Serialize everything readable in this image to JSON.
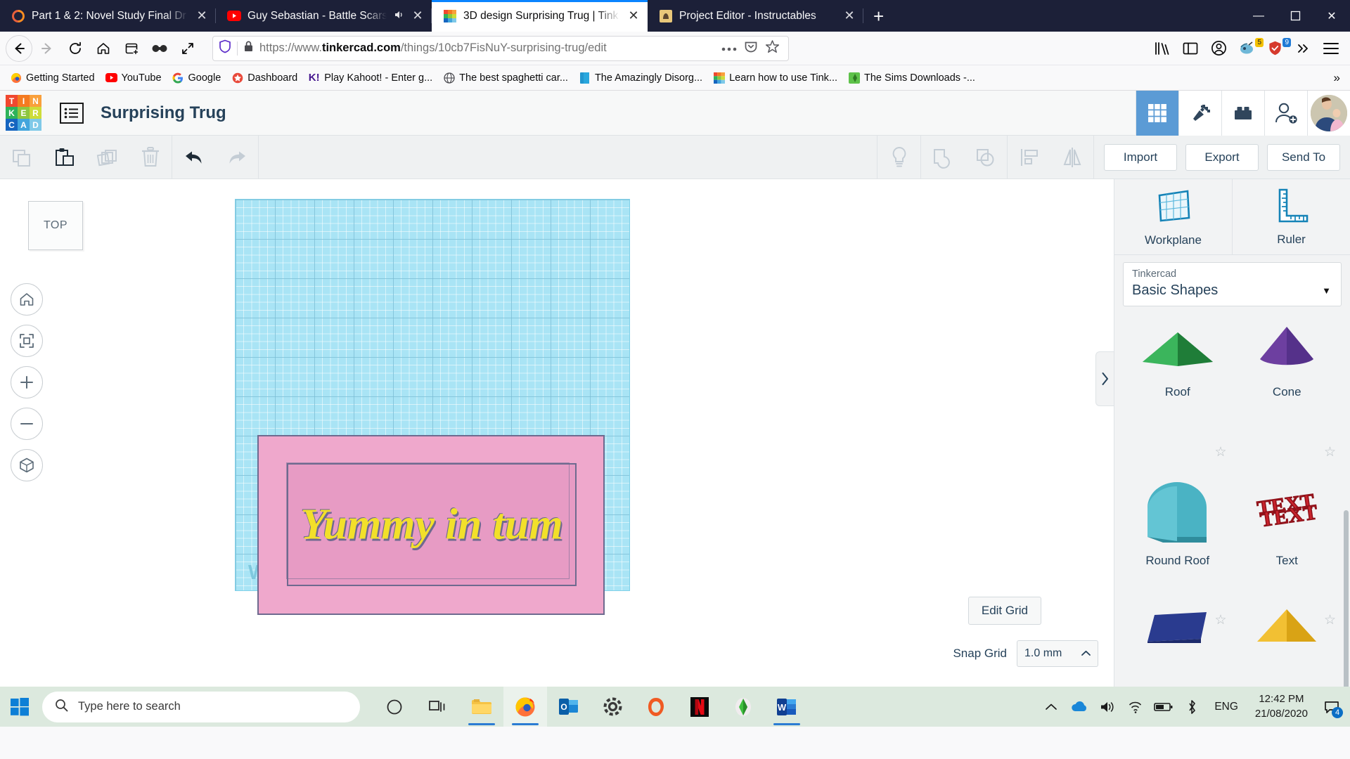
{
  "browser": {
    "tabs": [
      {
        "title": "Part 1 & 2: Novel Study Final Dr",
        "favicon": "firefox-circle-icon",
        "audio": "",
        "active": false
      },
      {
        "title": "Guy Sebastian - Battle Scars",
        "favicon": "youtube-icon",
        "audio": "speaker-icon",
        "active": false
      },
      {
        "title": "3D design Surprising Trug | Tink",
        "favicon": "tinkercad-icon",
        "audio": "",
        "active": true
      },
      {
        "title": "Project Editor - Instructables",
        "favicon": "instructables-icon",
        "audio": "",
        "active": false
      }
    ],
    "new_tab_label": "+",
    "window_controls": {
      "minimize": "—",
      "maximize": "☐",
      "close": "✕"
    },
    "nav": {
      "back": "back-arrow",
      "forward": "forward-arrow",
      "reload": "reload-arrow",
      "home": "home-icon",
      "container": "new-container-tab-icon",
      "mask": "private-mask-icon",
      "fullscreen": "expand-icon"
    },
    "url": {
      "scheme": "https://www.",
      "domain": "tinkercad.com",
      "path": "/things/10cb7FisNuY-surprising-trug/edit",
      "shield_icon": "shield-icon",
      "lock_icon": "padlock-icon",
      "page_actions_icon": "ellipsis-icon",
      "pocket_icon": "pocket-icon",
      "bookmark_icon": "star-icon"
    },
    "toolbar_right": {
      "library": "library-icon",
      "sidebar": "sidebar-icon",
      "account": "account-circle-icon",
      "extension": "extension-icon",
      "badge_yellow": "5",
      "badge_blue": "9",
      "overflow": "chevron-double-right-icon",
      "menu": "hamburger-menu-icon"
    },
    "bookmarks": [
      {
        "label": "Getting Started",
        "icon": "firefox-icon"
      },
      {
        "label": "YouTube",
        "icon": "youtube-icon"
      },
      {
        "label": "Google",
        "icon": "google-icon"
      },
      {
        "label": "Dashboard",
        "icon": "dashboard-icon"
      },
      {
        "label": "Play Kahoot! - Enter g...",
        "icon": "kahoot-icon"
      },
      {
        "label": "The best spaghetti car...",
        "icon": "globe-icon"
      },
      {
        "label": "The Amazingly Disorg...",
        "icon": "doc-icon"
      },
      {
        "label": "Learn how to use Tink...",
        "icon": "tinkercad-icon"
      },
      {
        "label": "The Sims Downloads -...",
        "icon": "sims-icon"
      }
    ],
    "bookmarks_overflow": "»"
  },
  "tinkercad": {
    "logo_tiles": [
      {
        "letter": "T",
        "color": "#f0482f"
      },
      {
        "letter": "I",
        "color": "#f47a20"
      },
      {
        "letter": "N",
        "color": "#f9a03c"
      },
      {
        "letter": "K",
        "color": "#2eb35a"
      },
      {
        "letter": "E",
        "color": "#8dc63f"
      },
      {
        "letter": "R",
        "color": "#cddc39"
      },
      {
        "letter": "C",
        "color": "#1565c0"
      },
      {
        "letter": "A",
        "color": "#42a5dd"
      },
      {
        "letter": "D",
        "color": "#7fc9e8"
      }
    ],
    "project_title": "Surprising Trug",
    "menu_icon": "list-menu-icon",
    "header_buttons": [
      {
        "name": "grid-view-button",
        "icon": "grid-icon",
        "active": true
      },
      {
        "name": "minecraft-button",
        "icon": "pickaxe-icon",
        "active": false
      },
      {
        "name": "blocks-button",
        "icon": "lego-brick-icon",
        "active": false
      },
      {
        "name": "invite-button",
        "icon": "person-add-icon",
        "active": false
      }
    ],
    "avatar": "user-avatar",
    "toolbar": {
      "left_tools": [
        {
          "name": "copy-button",
          "icon": "copy-icon",
          "enabled": false
        },
        {
          "name": "paste-button",
          "icon": "clipboard-paste-icon",
          "enabled": true
        },
        {
          "name": "duplicate-button",
          "icon": "duplicate-icon",
          "enabled": false
        },
        {
          "name": "delete-button",
          "icon": "trash-icon",
          "enabled": false
        }
      ],
      "history_tools": [
        {
          "name": "undo-button",
          "icon": "undo-arrow-icon",
          "enabled": true
        },
        {
          "name": "redo-button",
          "icon": "redo-arrow-icon",
          "enabled": false
        }
      ],
      "right_tools": [
        {
          "name": "hide-button",
          "icon": "lightbulb-icon",
          "enabled": false
        },
        {
          "name": "group-button",
          "icon": "group-shapes-icon",
          "enabled": false
        },
        {
          "name": "ungroup-button",
          "icon": "ungroup-shapes-icon",
          "enabled": false
        },
        {
          "name": "align-button",
          "icon": "align-icon",
          "enabled": false
        },
        {
          "name": "mirror-button",
          "icon": "mirror-icon",
          "enabled": false
        }
      ],
      "actions": [
        {
          "name": "import-button",
          "label": "Import"
        },
        {
          "name": "export-button",
          "label": "Export"
        },
        {
          "name": "send-to-button",
          "label": "Send To"
        }
      ]
    },
    "canvas": {
      "view_cube_label": "TOP",
      "nav_buttons": [
        {
          "name": "home-view-button",
          "icon": "home-icon"
        },
        {
          "name": "fit-view-button",
          "icon": "fit-all-icon"
        },
        {
          "name": "zoom-in-button",
          "icon": "plus-icon"
        },
        {
          "name": "zoom-out-button",
          "icon": "minus-icon"
        },
        {
          "name": "ortho-perspective-button",
          "icon": "cube-icon"
        }
      ],
      "workplane_label": "Workplane",
      "object_text": "Yummy in tum",
      "slab_color": "#efa8cc",
      "text_color": "#f2e02a",
      "outline_color": "#6e6a8f",
      "edit_grid_label": "Edit Grid",
      "snap_grid_label": "Snap Grid",
      "snap_grid_value": "1.0 mm",
      "panel_toggle_icon": "chevron-right-icon"
    },
    "panel": {
      "tools": [
        {
          "name": "workplane-tool",
          "label": "Workplane",
          "icon": "workplane-icon"
        },
        {
          "name": "ruler-tool",
          "label": "Ruler",
          "icon": "ruler-icon"
        }
      ],
      "library_owner": "Tinkercad",
      "library_name": "Basic Shapes",
      "caret_icon": "chevron-down-icon",
      "shapes": [
        {
          "label": "Roof",
          "color": "#2e9e4b",
          "starred": false,
          "art": "roof"
        },
        {
          "label": "Cone",
          "color": "#6d3fa0",
          "starred": false,
          "art": "cone"
        },
        {
          "label": "Round Roof",
          "color": "#4ab3c4",
          "starred": false,
          "art": "round-roof"
        },
        {
          "label": "Text",
          "color": "#c8232c",
          "starred": false,
          "art": "text"
        },
        {
          "label": "",
          "color": "#2a3b8f",
          "starred": false,
          "art": "prism"
        },
        {
          "label": "",
          "color": "#f2c033",
          "starred": false,
          "art": "pyramid"
        }
      ],
      "star_icon": "star-outline-icon"
    }
  },
  "taskbar": {
    "start_icon": "windows-logo-icon",
    "search_placeholder": "Type here to search",
    "search_icon": "magnifier-icon",
    "items": [
      {
        "name": "cortana-button",
        "icon": "cortana-circle-icon"
      },
      {
        "name": "task-view-button",
        "icon": "task-view-icon"
      },
      {
        "name": "file-explorer-button",
        "icon": "folder-icon",
        "open": true
      },
      {
        "name": "firefox-button",
        "icon": "firefox-icon",
        "open": true,
        "active": true
      },
      {
        "name": "outlook-button",
        "icon": "outlook-icon",
        "open": false
      },
      {
        "name": "settings-button",
        "icon": "gear-icon",
        "open": false
      },
      {
        "name": "origin-button",
        "icon": "origin-icon",
        "open": false
      },
      {
        "name": "netflix-button",
        "icon": "netflix-icon",
        "open": false
      },
      {
        "name": "sims-button",
        "icon": "sims-plumbob-icon",
        "open": false
      },
      {
        "name": "word-button",
        "icon": "word-icon",
        "open": true
      }
    ],
    "tray": [
      {
        "name": "show-hidden-icons",
        "icon": "chevron-up-icon"
      },
      {
        "name": "onedrive-icon",
        "icon": "cloud-icon"
      },
      {
        "name": "volume-icon",
        "icon": "speaker-icon"
      },
      {
        "name": "network-icon",
        "icon": "wifi-icon"
      },
      {
        "name": "battery-icon",
        "icon": "battery-icon"
      },
      {
        "name": "bluetooth-icon",
        "icon": "bluetooth-icon"
      }
    ],
    "language": "ENG",
    "time": "12:42 PM",
    "date": "21/08/2020",
    "notification_count": "4"
  }
}
